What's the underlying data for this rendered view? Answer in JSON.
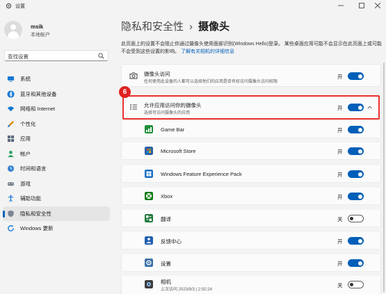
{
  "window": {
    "title": "设置"
  },
  "user": {
    "name": "msik",
    "account_type": "本地帐户"
  },
  "search": {
    "placeholder": "查找设置"
  },
  "sidebar": {
    "items": [
      {
        "label": "系统",
        "icon": "monitor-icon"
      },
      {
        "label": "蓝牙和其他设备",
        "icon": "bluetooth-icon"
      },
      {
        "label": "网络和 Internet",
        "icon": "wifi-icon"
      },
      {
        "label": "个性化",
        "icon": "brush-icon"
      },
      {
        "label": "应用",
        "icon": "apps-icon"
      },
      {
        "label": "帐户",
        "icon": "person-icon"
      },
      {
        "label": "时间和语言",
        "icon": "globe-clock-icon"
      },
      {
        "label": "游戏",
        "icon": "gamepad-icon"
      },
      {
        "label": "辅助功能",
        "icon": "accessibility-icon"
      },
      {
        "label": "隐私和安全性",
        "icon": "shield-icon",
        "active": true
      },
      {
        "label": "Windows 更新",
        "icon": "update-icon"
      }
    ]
  },
  "breadcrumb": {
    "parent": "隐私和安全性",
    "separator": "›",
    "current": "摄像头"
  },
  "description": {
    "text": "此页面上的设置不会阻止你通过摄像头使用面部识别(Windows Hello)登录。 某些桌面应用可能不会显示在此页面上或可能不会受到这些设置的影响。",
    "link": "了解有关相机的详细信息"
  },
  "camera_access": {
    "title": "摄像头访问",
    "subtitle": "任何使用此设备的人都可以选择他们的应用是否有权访问摄像头访问权限",
    "state_label": "开",
    "on": true
  },
  "app_access": {
    "title": "允许应用访问你的摄像头",
    "subtitle": "选择可访问摄像头的应用",
    "state_label": "开",
    "on": true,
    "expanded": true
  },
  "annotation": {
    "step": "6"
  },
  "apps": [
    {
      "name": "Game Bar",
      "state_label": "开",
      "on": true,
      "icon": "gamebar-icon",
      "color": "#1e8f3a"
    },
    {
      "name": "Microsoft Store",
      "state_label": "开",
      "on": true,
      "icon": "store-icon",
      "color": "#2b5fa8"
    },
    {
      "name": "Windows Feature Experience Pack",
      "state_label": "开",
      "on": true,
      "icon": "windows-icon",
      "color": "#1a6fc4"
    },
    {
      "name": "Xbox",
      "state_label": "开",
      "on": true,
      "icon": "xbox-icon",
      "color": "#107c10"
    },
    {
      "name": "翻译",
      "state_label": "关",
      "on": false,
      "icon": "translate-icon",
      "color": "#1f7a3c"
    },
    {
      "name": "反馈中心",
      "state_label": "开",
      "on": true,
      "icon": "feedback-icon",
      "color": "#1f5fb0"
    },
    {
      "name": "设置",
      "state_label": "开",
      "on": true,
      "icon": "settings-icon",
      "color": "#3a6fa8"
    },
    {
      "name": "相机",
      "subtitle": "上次访问 2023/9/3 | 2:50:24",
      "state_label": "关",
      "on": false,
      "icon": "camera-app-icon",
      "color": "#3d3d3d"
    }
  ],
  "colors": {
    "accent": "#005fb8",
    "highlight": "#e8312d",
    "badge": "#e02020"
  }
}
